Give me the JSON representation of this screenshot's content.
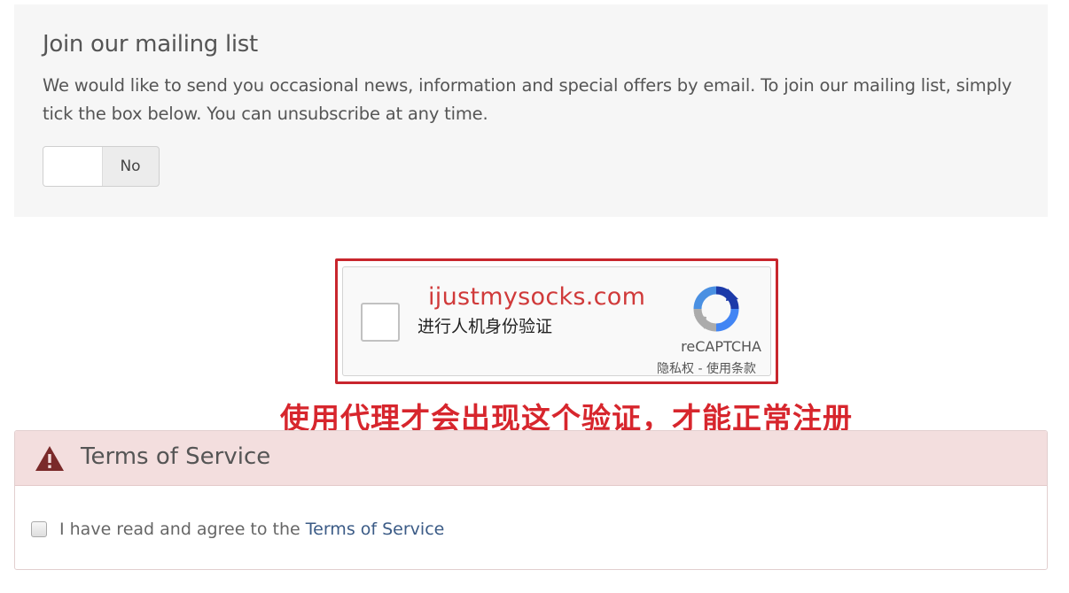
{
  "mailing": {
    "title": "Join our mailing list",
    "description": "We would like to send you occasional news, information and special offers by email. To join our mailing list, simply tick the box below. You can unsubscribe at any time.",
    "toggle_label": "No"
  },
  "captcha": {
    "watermark": "ijustmysocks.com",
    "checkbox_label": "进行人机身份验证",
    "brand": "reCAPTCHA",
    "links": "隐私权 - 使用条款",
    "icon": "recaptcha-logo"
  },
  "annotation": "使用代理才会出现这个验证，才能正常注册",
  "tos": {
    "title": "Terms of Service",
    "agree_prefix": "I have read and agree to the ",
    "agree_link": "Terms of Service",
    "icon": "warning-icon"
  },
  "colors": {
    "accent_red": "#c8262d",
    "tos_header_bg": "#f3dede",
    "link": "#3b5b86"
  }
}
